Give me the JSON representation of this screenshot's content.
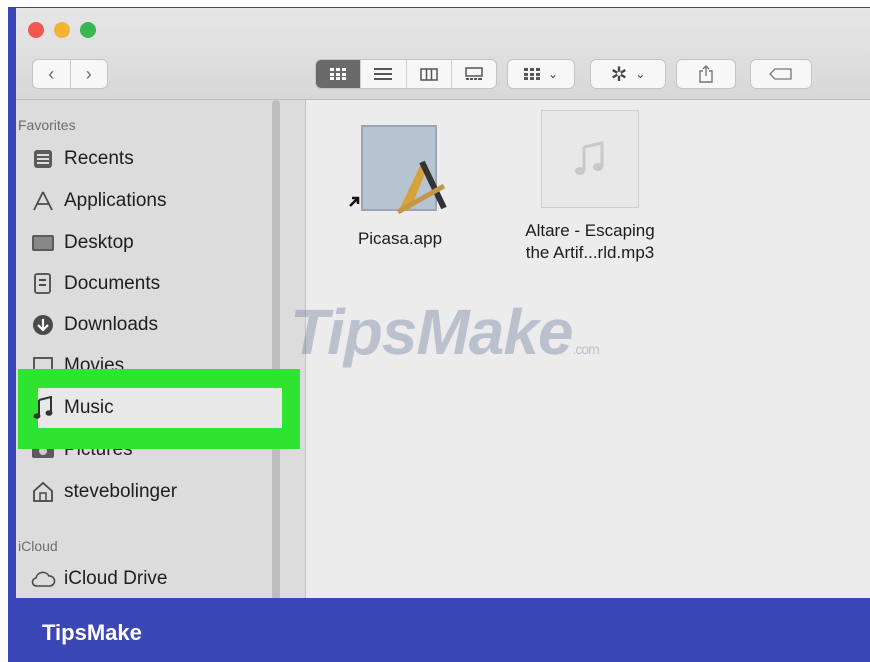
{
  "sidebar": {
    "favorites_title": "Favorites",
    "items": [
      {
        "label": "Recents",
        "icon": "recents-icon"
      },
      {
        "label": "Applications",
        "icon": "applications-icon"
      },
      {
        "label": "Desktop",
        "icon": "desktop-icon"
      },
      {
        "label": "Documents",
        "icon": "documents-icon"
      },
      {
        "label": "Downloads",
        "icon": "downloads-icon"
      },
      {
        "label": "Movies",
        "icon": "movies-icon"
      },
      {
        "label": "Music",
        "icon": "music-icon"
      },
      {
        "label": "Pictures",
        "icon": "pictures-icon"
      },
      {
        "label": "stevebolinger",
        "icon": "home-icon"
      }
    ],
    "icloud_title": "iCloud",
    "icloud_items": [
      {
        "label": "iCloud Drive",
        "icon": "cloud-icon"
      }
    ]
  },
  "files": [
    {
      "name": "Picasa.app",
      "icon": "application-icon"
    },
    {
      "name_line1": "Altare - Escaping",
      "name_line2": "the Artif...rld.mp3",
      "icon": "audio-file-icon"
    }
  ],
  "watermark": {
    "text": "TipsMake",
    "suffix": ".com"
  },
  "brand": "TipsMake",
  "colors": {
    "highlight": "#2fe431",
    "frame": "#3b47b5"
  }
}
